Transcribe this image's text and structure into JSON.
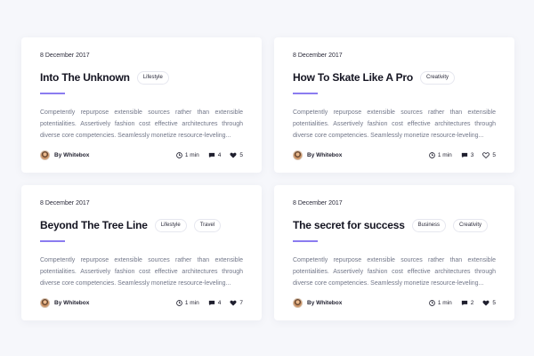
{
  "posts": [
    {
      "date": "8 December 2017",
      "title": "Into The Unknown",
      "tags": [
        "Lifestyle"
      ],
      "excerpt": "Competently repurpose extensible sources rather than extensible potentialities. Assertively fashion cost effective architectures through diverse core competencies. Seamlessly monetize resource-leveling...",
      "author": "By Whitebox",
      "read_time": "1 min",
      "comments": "4",
      "likes": "5",
      "liked": true
    },
    {
      "date": "8 December 2017",
      "title": "How To Skate Like A Pro",
      "tags": [
        "Creativity"
      ],
      "excerpt": "Competently repurpose extensible sources rather than extensible potentialities. Assertively fashion cost effective architectures through diverse core competencies. Seamlessly monetize resource-leveling...",
      "author": "By Whitebox",
      "read_time": "1 min",
      "comments": "3",
      "likes": "5",
      "liked": false
    },
    {
      "date": "8 December 2017",
      "title": "Beyond The Tree Line",
      "tags": [
        "Lifestyle",
        "Travel"
      ],
      "excerpt": "Competently repurpose extensible sources rather than extensible potentialities. Assertively fashion cost effective architectures through diverse core competencies. Seamlessly monetize resource-leveling...",
      "author": "By Whitebox",
      "read_time": "1 min",
      "comments": "4",
      "likes": "7",
      "liked": true
    },
    {
      "date": "8 December 2017",
      "title": "The secret for success",
      "tags": [
        "Business",
        "Creativity"
      ],
      "excerpt": "Competently repurpose extensible sources rather than extensible potentialities. Assertively fashion cost effective architectures through diverse core competencies. Seamlessly monetize resource-leveling...",
      "author": "By Whitebox",
      "read_time": "1 min",
      "comments": "2",
      "likes": "5",
      "liked": true
    }
  ],
  "colors": {
    "background": "#f6f7fb",
    "card": "#ffffff",
    "accent": "#8b7cf0",
    "text": "#1f1f2e",
    "muted": "#727789"
  },
  "icons": {
    "time": "clock-icon",
    "comments": "comment-icon",
    "likes": "heart-icon"
  }
}
